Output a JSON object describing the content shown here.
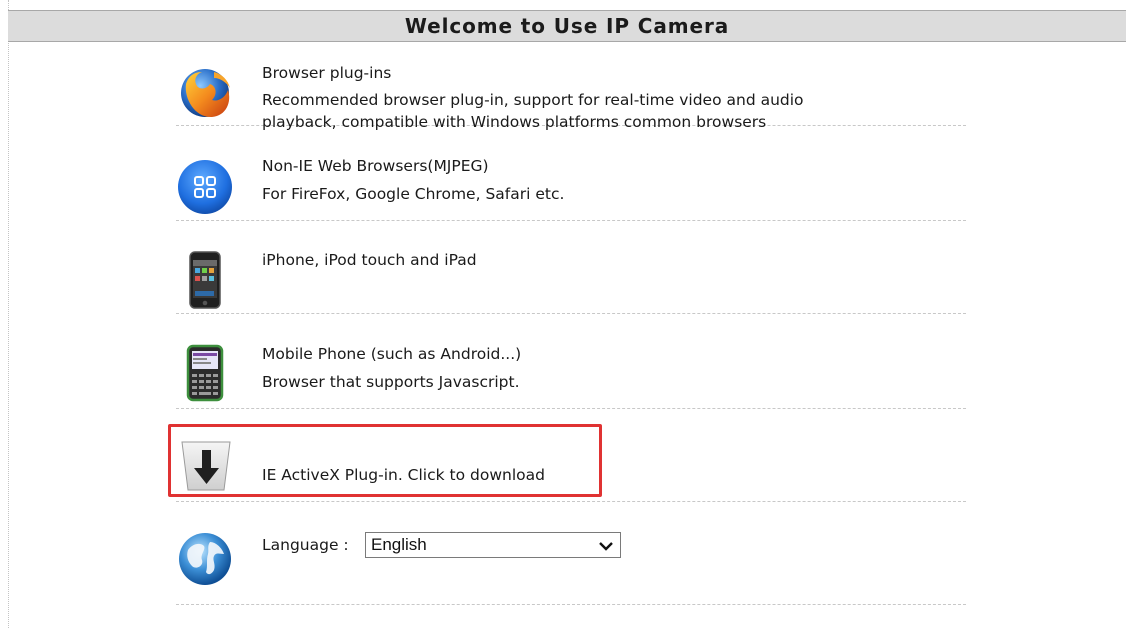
{
  "header": {
    "title": "Welcome to Use IP Camera"
  },
  "items": [
    {
      "icon": "firefox-icon",
      "title": "Browser plug-ins",
      "desc_line1": "Recommended browser plug-in, support for real-time video and audio",
      "desc_line2": "playback, compatible with Windows platforms common browsers"
    },
    {
      "icon": "app-grid-icon",
      "title": "Non-IE Web Browsers(MJPEG)",
      "desc_line1": "For FireFox, Google Chrome, Safari etc."
    },
    {
      "icon": "iphone-icon",
      "title": "iPhone, iPod touch and iPad"
    },
    {
      "icon": "mobile-phone-icon",
      "title": "Mobile Phone (such as Android...)",
      "desc_line1": "Browser that supports Javascript."
    },
    {
      "icon": "download-arrow-icon",
      "title": "IE ActiveX Plug-in. Click to download"
    }
  ],
  "language": {
    "icon": "globe-icon",
    "label": "Language :",
    "selected": "English"
  },
  "colors": {
    "header_bg": "#dcdcdc",
    "highlight_border": "#e03232"
  }
}
